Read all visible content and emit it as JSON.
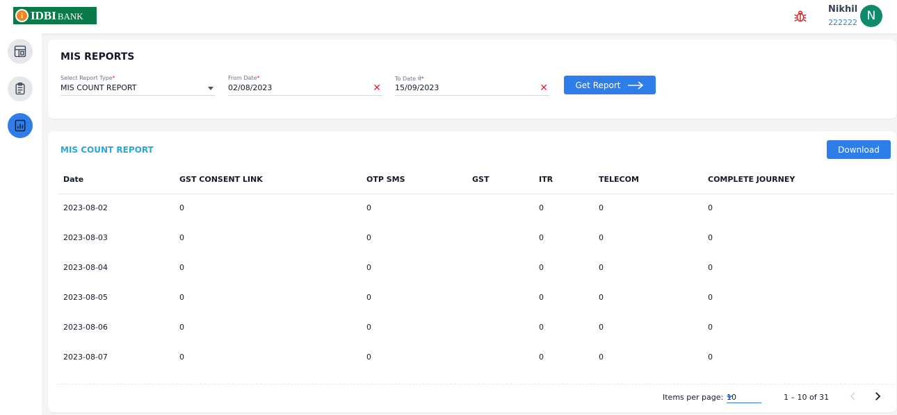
{
  "header": {
    "brand": "IDBI",
    "brand_suffix": "BANK",
    "user_name": "Nikhil",
    "user_id": "222222",
    "avatar_initial": "N"
  },
  "sidebar": {
    "items": [
      {
        "icon": "dashboard-icon"
      },
      {
        "icon": "clipboard-icon"
      },
      {
        "icon": "reports-chart-icon",
        "active": true
      }
    ]
  },
  "report_form": {
    "title": "MIS REPORTS",
    "report_type_label": "Select Report Type",
    "report_type_value": "MIS COUNT REPORT",
    "from_label": "From Date",
    "from_value": "02/08/2023",
    "to_label": "To Date थे",
    "to_value": "15/09/2023",
    "required_mark": "*",
    "get_report_label": "Get Report"
  },
  "report_table": {
    "title": "MIS COUNT REPORT",
    "download_label": "Download",
    "columns": [
      "Date",
      "GST CONSENT LINK",
      "OTP SMS",
      "GST",
      "ITR",
      "TELECOM",
      "COMPLETE JOURNEY"
    ],
    "rows": [
      {
        "date": "2023-08-02",
        "gst_link": "0",
        "otp": "0",
        "gst": "",
        "itr": "0",
        "telecom": "0",
        "journey": "0"
      },
      {
        "date": "2023-08-03",
        "gst_link": "0",
        "otp": "0",
        "gst": "",
        "itr": "0",
        "telecom": "0",
        "journey": "0"
      },
      {
        "date": "2023-08-04",
        "gst_link": "0",
        "otp": "0",
        "gst": "",
        "itr": "0",
        "telecom": "0",
        "journey": "0"
      },
      {
        "date": "2023-08-05",
        "gst_link": "0",
        "otp": "0",
        "gst": "",
        "itr": "0",
        "telecom": "0",
        "journey": "0"
      },
      {
        "date": "2023-08-06",
        "gst_link": "0",
        "otp": "0",
        "gst": "",
        "itr": "0",
        "telecom": "0",
        "journey": "0"
      },
      {
        "date": "2023-08-07",
        "gst_link": "0",
        "otp": "0",
        "gst": "",
        "itr": "0",
        "telecom": "0",
        "journey": "0"
      }
    ]
  },
  "pagination": {
    "items_per_page_label": "Items per page:",
    "items_per_page_value": "10",
    "range_label": "1 – 10 of 31"
  },
  "colors": {
    "primary": "#2f7de8",
    "section_title": "#2aa7d8",
    "avatar": "#0f8a6c",
    "brand_green": "#0b7a4b",
    "clear_red": "#dc2626"
  }
}
